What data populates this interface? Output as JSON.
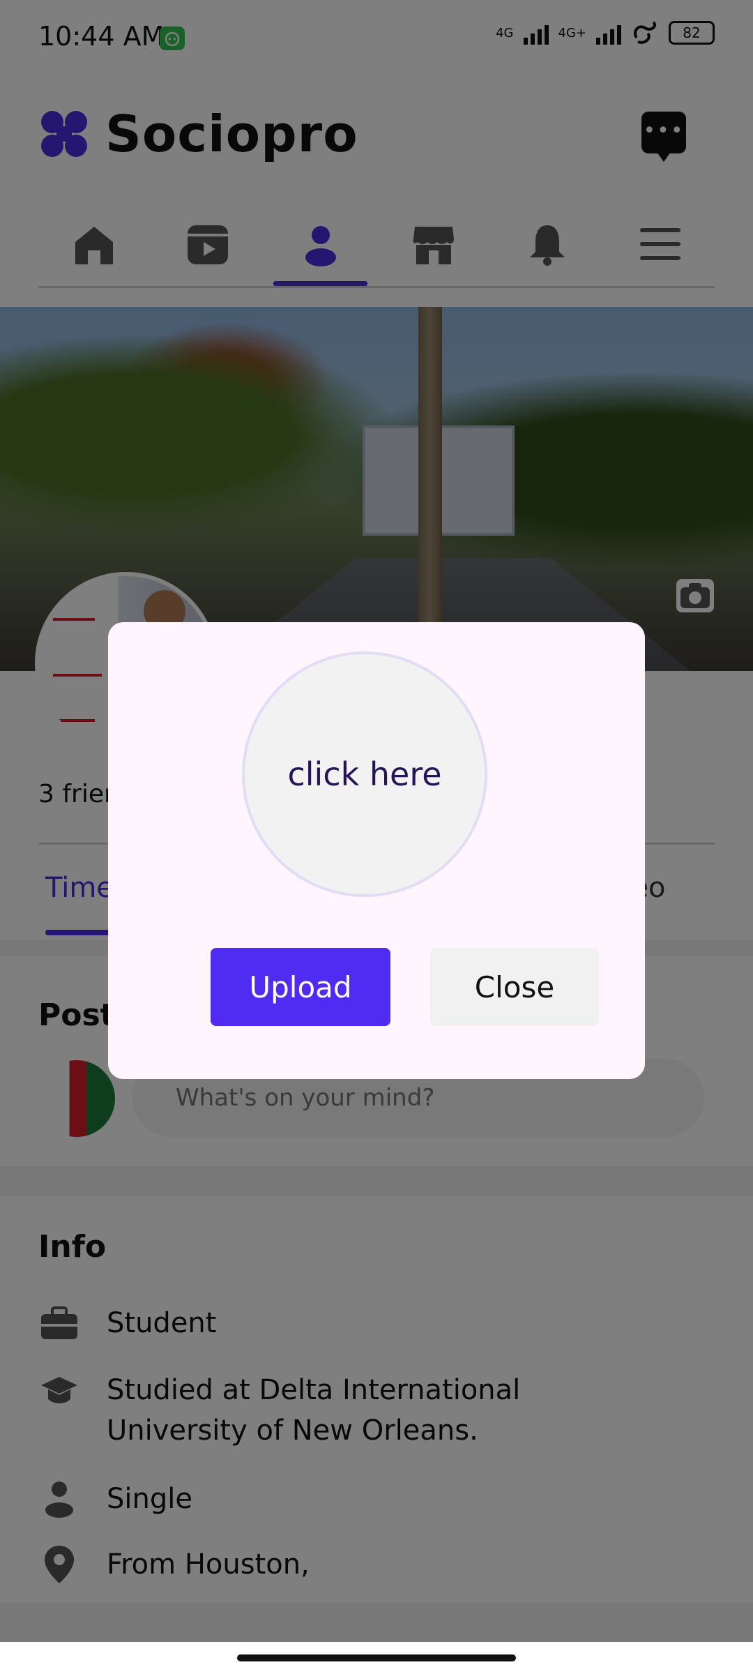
{
  "status_bar": {
    "time": "10:44 AM",
    "network_1": "4G",
    "network_2": "4G+",
    "battery": "82"
  },
  "header": {
    "app_name": "Sociopro",
    "brand_color": "#4a2fe0"
  },
  "nav_tabs": [
    {
      "icon": "home-icon",
      "active": false
    },
    {
      "icon": "video-icon",
      "active": false
    },
    {
      "icon": "profile-icon",
      "active": true
    },
    {
      "icon": "store-icon",
      "active": false
    },
    {
      "icon": "bell-icon",
      "active": false
    },
    {
      "icon": "menu-icon",
      "active": false
    }
  ],
  "profile": {
    "friends_text": "3 frien",
    "sub_tabs": {
      "timeline": "Time",
      "video": "deo"
    }
  },
  "posts": {
    "title": "Post",
    "placeholder": "What's on your mind?"
  },
  "info": {
    "title": "Info",
    "items": [
      {
        "icon": "briefcase-icon",
        "text": "Student"
      },
      {
        "icon": "graduation-cap-icon",
        "text_line1": "Studied at Delta International",
        "text_line2": "University of New Orleans."
      },
      {
        "icon": "person-icon",
        "text": "Single"
      },
      {
        "icon": "location-pin-icon",
        "text": "From Houston,"
      }
    ]
  },
  "modal": {
    "circle_text": "click here",
    "upload_label": "Upload",
    "close_label": "Close",
    "upload_color": "#4f2cf2"
  }
}
